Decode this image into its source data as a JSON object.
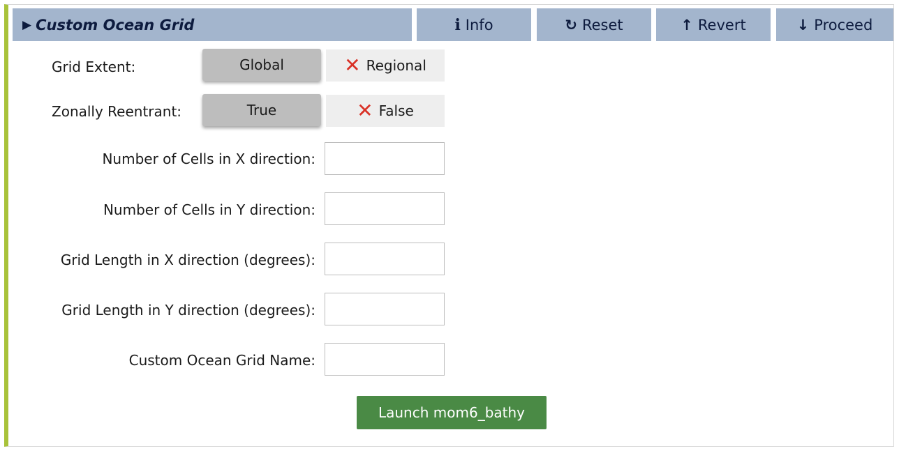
{
  "header": {
    "title": "Custom Ocean Grid",
    "expand_glyph": "▶",
    "buttons": {
      "info": {
        "icon": "info-icon",
        "glyph": "i",
        "label": "Info"
      },
      "reset": {
        "icon": "reset-icon",
        "glyph": "↻",
        "label": "Reset"
      },
      "revert": {
        "icon": "arrow-up-icon",
        "glyph": "↑",
        "label": "Revert"
      },
      "proceed": {
        "icon": "arrow-down-icon",
        "glyph": "↓",
        "label": "Proceed"
      }
    }
  },
  "form": {
    "grid_extent": {
      "label": "Grid Extent:",
      "options": [
        {
          "label": "Global",
          "selected": true
        },
        {
          "label": "Regional",
          "selected": false
        }
      ]
    },
    "zonally_reentrant": {
      "label": "Zonally Reentrant:",
      "options": [
        {
          "label": "True",
          "selected": true
        },
        {
          "label": "False",
          "selected": false
        }
      ]
    },
    "fields": [
      {
        "label": "Number of Cells in X direction:",
        "value": ""
      },
      {
        "label": "Number of Cells in Y direction:",
        "value": ""
      },
      {
        "label": "Grid Length in X direction (degrees):",
        "value": ""
      },
      {
        "label": "Grid Length in Y direction (degrees):",
        "value": ""
      },
      {
        "label": "Custom Ocean Grid Name:",
        "value": ""
      }
    ],
    "unselected_glyph": "✕",
    "launch_label": "Launch mom6_bathy"
  },
  "colors": {
    "header_bg": "#a3b5cd",
    "accent_border": "#a8c23a",
    "launch_bg": "#4a8a45",
    "unselected_mark": "#d93025"
  }
}
